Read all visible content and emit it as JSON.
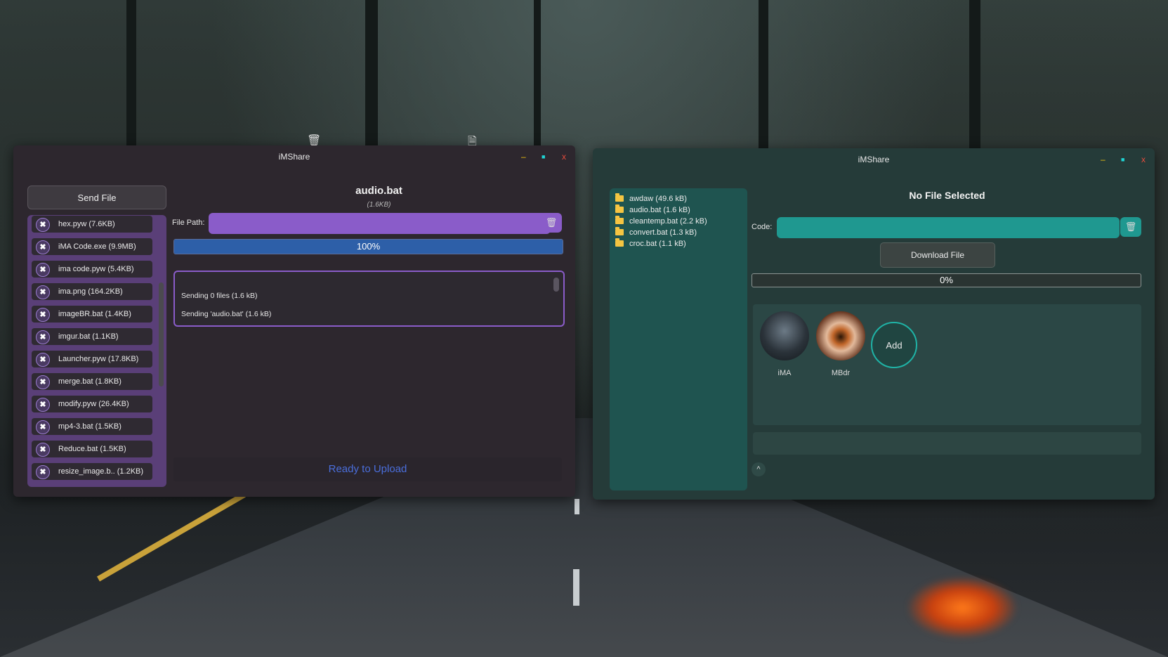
{
  "desktop": {
    "icons": [
      "trash-icon",
      "file-icon"
    ]
  },
  "sender": {
    "title": "iMShare",
    "controls": {
      "min": "–",
      "max": "■",
      "close": "x"
    },
    "send_label": "Send File",
    "files": [
      "hex.pyw (7.6KB)",
      "iMA Code.exe (9.9MB)",
      "ima code.pyw (5.4KB)",
      "ima.png (164.2KB)",
      "imageBR.bat (1.4KB)",
      "imgur.bat (1.1KB)",
      "Launcher.pyw (17.8KB)",
      "merge.bat (1.8KB)",
      "modify.pyw (26.4KB)",
      "mp4-3.bat (1.5KB)",
      "Reduce.bat (1.5KB)",
      "resize_image.b.. (1.2KB)"
    ],
    "file_name": "audio.bat",
    "file_size": "(1.6KB)",
    "path_label": "File Path:",
    "progress": {
      "value": 100,
      "label": "100%"
    },
    "log": [
      "Sending 0 files (1.6 kB)",
      "Sending 'audio.bat' (1.6 kB)"
    ],
    "status": "Ready to Upload",
    "colors": {
      "accent": "#8a5cc9",
      "progress": "#2d5fa8",
      "status": "#4a6edb"
    }
  },
  "receiver": {
    "title": "iMShare",
    "controls": {
      "min": "–",
      "max": "■",
      "close": "x"
    },
    "folders": [
      "awdaw (49.6 kB)",
      "audio.bat (1.6 kB)",
      "cleantemp.bat (2.2 kB)",
      "convert.bat (1.3 kB)",
      "croc.bat (1.1 kB)"
    ],
    "selected_title": "No File Selected",
    "code_label": "Code:",
    "download_label": "Download File",
    "progress": {
      "value": 0,
      "label": "0%"
    },
    "contacts": [
      {
        "name": "iMA"
      },
      {
        "name": "MBdr"
      }
    ],
    "add_label": "Add",
    "up_arrow": "^",
    "colors": {
      "accent": "#1f9890"
    }
  }
}
